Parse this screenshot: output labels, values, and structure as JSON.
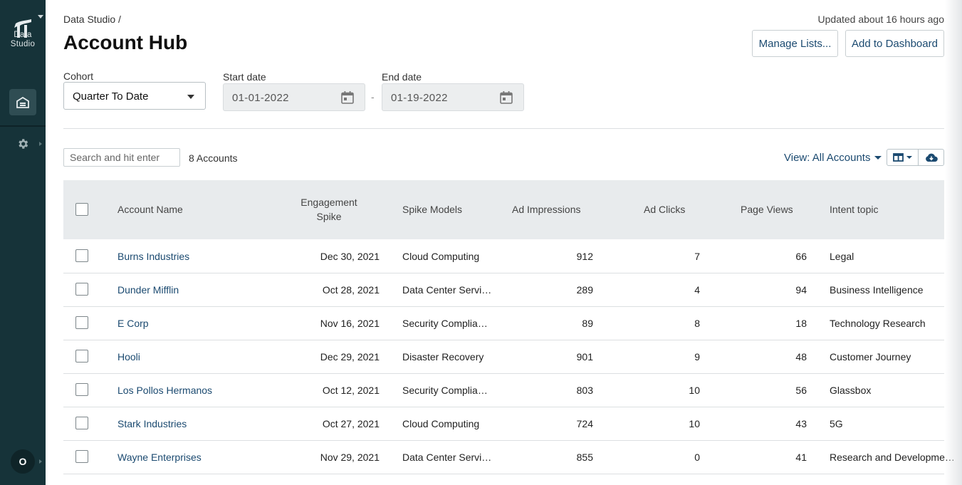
{
  "app": {
    "logo_text_1": "Data",
    "logo_text_2": "Studio",
    "avatar_initial": "O"
  },
  "breadcrumb": "Data Studio /",
  "page_title": "Account Hub",
  "updated_text": "Updated about 16 hours ago",
  "buttons": {
    "manage_lists": "Manage Lists...",
    "add_dashboard": "Add to Dashboard"
  },
  "filters": {
    "cohort_label": "Cohort",
    "cohort_value": "Quarter To Date",
    "start_label": "Start date",
    "start_value": "01-01-2022",
    "end_label": "End date",
    "end_value": "01-19-2022",
    "separator": "-"
  },
  "toolbar": {
    "search_placeholder": "Search and hit enter",
    "count_text": "8 Accounts",
    "view_label": "View: All Accounts"
  },
  "table": {
    "headers": {
      "account": "Account Name",
      "spike_1": "Engagement",
      "spike_2": "Spike",
      "models": "Spike Models",
      "impressions": "Ad Impressions",
      "clicks": "Ad Clicks",
      "views": "Page Views",
      "intent": "Intent topic"
    },
    "rows": [
      {
        "name": "Burns Industries",
        "spike": "Dec 30, 2021",
        "model": "Cloud Computing",
        "impressions": "912",
        "clicks": "7",
        "views": "66",
        "intent": "Legal"
      },
      {
        "name": "Dunder Mifflin",
        "spike": "Oct 28, 2021",
        "model": "Data Center Servi…",
        "impressions": "289",
        "clicks": "4",
        "views": "94",
        "intent": "Business Intelligence"
      },
      {
        "name": "E Corp",
        "spike": "Nov 16, 2021",
        "model": "Security Complia…",
        "impressions": "89",
        "clicks": "8",
        "views": "18",
        "intent": "Technology Research"
      },
      {
        "name": "Hooli",
        "spike": "Dec 29, 2021",
        "model": "Disaster Recovery",
        "impressions": "901",
        "clicks": "9",
        "views": "48",
        "intent": "Customer Journey"
      },
      {
        "name": "Los Pollos Hermanos",
        "spike": "Oct 12, 2021",
        "model": "Security Complia…",
        "impressions": "803",
        "clicks": "10",
        "views": "56",
        "intent": "Glassbox"
      },
      {
        "name": "Stark Industries",
        "spike": "Oct 27, 2021",
        "model": "Cloud Computing",
        "impressions": "724",
        "clicks": "10",
        "views": "43",
        "intent": "5G"
      },
      {
        "name": "Wayne Enterprises",
        "spike": "Nov 29, 2021",
        "model": "Data Center Servi…",
        "impressions": "855",
        "clicks": "0",
        "views": "41",
        "intent": "Research and Developme…"
      }
    ]
  },
  "icons": {
    "logo": "data-studio-logo-icon",
    "nav_active": "account-hub-icon",
    "settings": "gear-icon",
    "calendar": "calendar-icon",
    "columns": "columns-icon",
    "download": "cloud-download-icon"
  },
  "colors": {
    "sidebar": "#163339",
    "link": "#1b4a70",
    "header_bg": "#e8ebed"
  }
}
